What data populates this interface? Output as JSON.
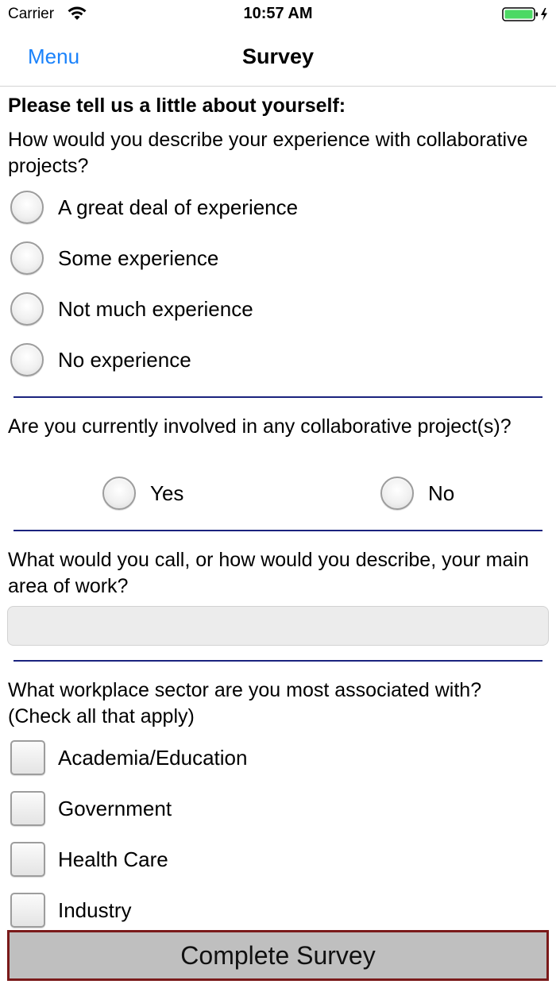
{
  "status_bar": {
    "carrier": "Carrier",
    "time": "10:57 AM",
    "battery_color": "#4cd964",
    "icons": [
      "wifi-icon",
      "battery-icon",
      "charging-bolt-icon"
    ]
  },
  "nav": {
    "menu_label": "Menu",
    "title": "Survey",
    "accent_color": "#1a82fb"
  },
  "survey": {
    "intro": "Please tell us a little about yourself:",
    "q1": {
      "question": "How would you describe your experience with collaborative projects?",
      "options": [
        "A great deal of experience",
        "Some experience",
        "Not much experience",
        "No experience"
      ]
    },
    "q2": {
      "question": "Are you currently involved in any collaborative project(s)?",
      "options": [
        "Yes",
        "No"
      ]
    },
    "q3": {
      "question": "What would you call, or how would you describe, your main area of work?",
      "value": "",
      "placeholder": ""
    },
    "q4": {
      "question": "What workplace sector are you most associated with? (Check all that apply)",
      "options": [
        "Academia/Education",
        "Government",
        "Health Care",
        "Industry"
      ]
    },
    "divider_color": "#1a237e"
  },
  "footer": {
    "complete_label": "Complete Survey",
    "border_color": "#7a1a1a"
  }
}
